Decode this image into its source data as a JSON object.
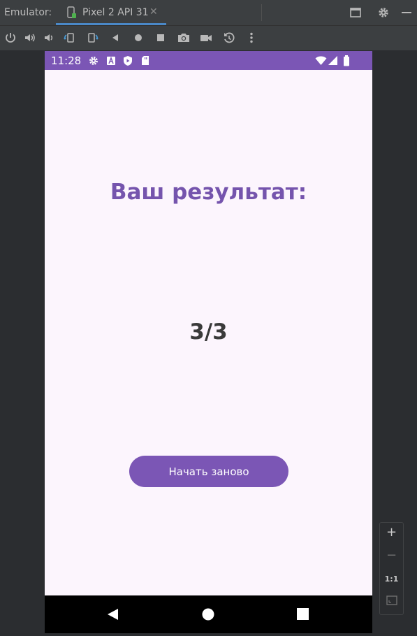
{
  "tabbar": {
    "emulator_label": "Emulator:",
    "tab_title": "Pixel 2 API 31",
    "close_glyph": "✕",
    "icons": [
      "device-icon",
      "restore-window-icon",
      "settings-icon",
      "minimize-icon"
    ]
  },
  "toolbar": {
    "icons": [
      "power-icon",
      "volume-up-icon",
      "volume-down-icon",
      "rotate-left-icon",
      "rotate-right-icon",
      "back-icon",
      "home-icon",
      "overview-icon",
      "screenshot-icon",
      "screen-record-icon",
      "snapshot-icon",
      "more-icon"
    ]
  },
  "phone": {
    "status_time": "11:28",
    "status_icons_left": [
      "settings-icon",
      "a-icon",
      "shield-play-icon",
      "sd-card-icon"
    ],
    "status_icons_right": [
      "wifi-icon",
      "signal-icon",
      "battery-icon"
    ],
    "title": "Ваш результат:",
    "score": "3/3",
    "restart_button": "Начать заново",
    "nav": [
      "back-icon",
      "home-icon",
      "recents-icon"
    ]
  },
  "zoom": {
    "zoom_in": "+",
    "zoom_out": "−",
    "one_to_one": "1:1"
  },
  "colors": {
    "accent": "#7b56b5",
    "title_color": "#7554ad",
    "screen_bg": "#fcf5fd",
    "ide_bg": "#2b2d30"
  }
}
